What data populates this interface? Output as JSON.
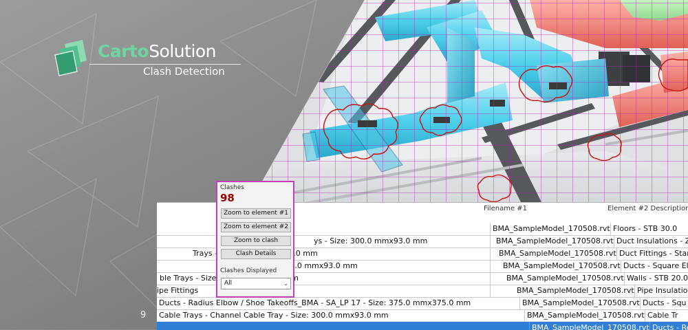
{
  "brand": {
    "name_part1": "Carto",
    "name_part2": "Solution",
    "subtitle": "Clash Detection"
  },
  "panel": {
    "clashes_label": "Clashes",
    "clashes_count": "98",
    "buttons": [
      "Zoom to element #1",
      "Zoom to element #2",
      "Zoom to clash",
      "Clash Details"
    ],
    "displayed_label": "Clashes Displayed",
    "displayed_value": "All"
  },
  "table": {
    "headers": {
      "filename": "Filename #1",
      "description": "Element #2 Description"
    },
    "rows": [
      {
        "name": "",
        "file": "BMA_SampleModel_170508.rvt",
        "desc": "Floors - STB 30.0"
      },
      {
        "name": "ys - Size: 300.0 mmx93.0 mm",
        "file": "BMA_SampleModel_170508.rvt",
        "desc": "Duct Insulations - ZZ"
      },
      {
        "name": "Trays - Size: 300.0 mmx93.0 mm",
        "file": "BMA_SampleModel_170508.rvt",
        "desc": "Duct Fittings - Stand"
      },
      {
        "name": "Trays - Size: 300.0 mmx93.0 mm",
        "file": "BMA_SampleModel_170508.rvt",
        "desc": "Ducts - Square Elb"
      },
      {
        "name": "ble Trays - Size: 300.0 mmx93.0 mm",
        "file": "BMA_SampleModel_170508.rvt",
        "desc": "Walls - STB 20.0"
      },
      {
        "name": "ipe Fittings",
        "file": "BMA_SampleModel_170508.rvt",
        "desc": "Pipe Insulation"
      },
      {
        "name": "Ducts - Radius Elbow / Shoe Takeoffs_BMA - SA_LP 17 - Size: 375.0 mmx375.0 mm",
        "file": "BMA_SampleModel_170508.rvt",
        "desc": "Ducts - Squ"
      },
      {
        "name": "Cable Trays - Channel Cable Tray - Size: 300.0 mmx93.0 mm",
        "file": "BMA_SampleModel_170508.rvt",
        "desc": "Cable Tr"
      },
      {
        "name": "",
        "file": "BMA_SampleModel_170508.rvt",
        "desc": "Ducts - Re"
      }
    ],
    "row_numbers": [
      "9"
    ]
  },
  "colors": {
    "brand_accent": "#6fd3a2",
    "duct": "#3ec7e6",
    "red_duct": "#f0786c",
    "green_duct": "#7cd67c",
    "clash_outline": "#cc1111",
    "grid": "#b41fb4",
    "panel_border": "#c63fb8",
    "count": "#a00000",
    "selection": "#2f7fd6"
  }
}
